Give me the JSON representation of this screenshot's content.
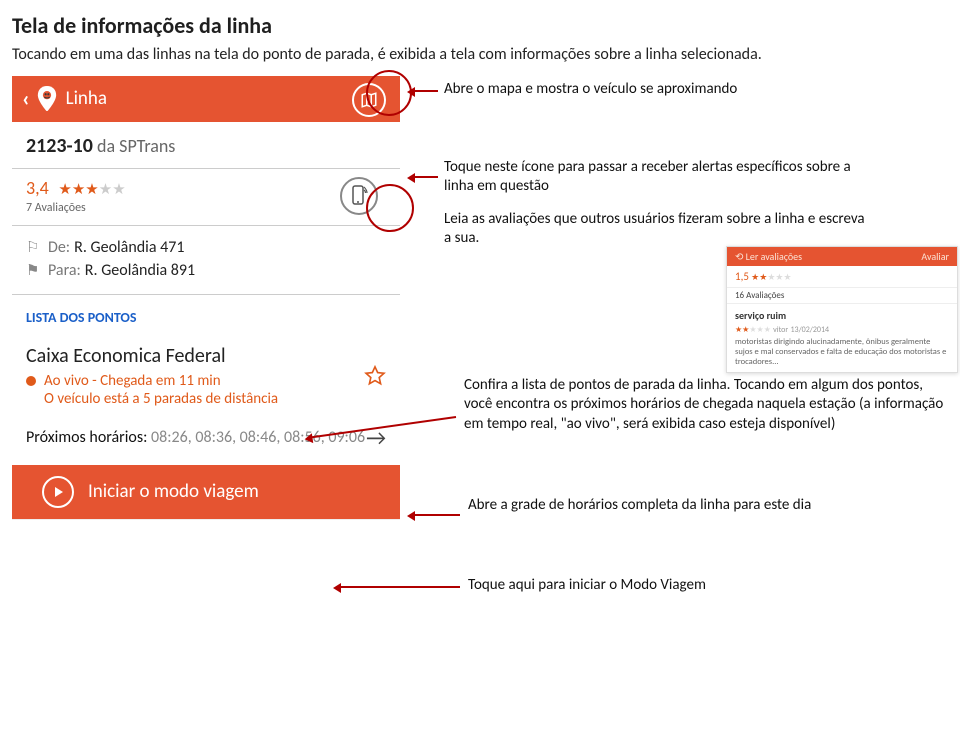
{
  "title": "Tela de informações da linha",
  "subtitle": "Tocando em uma das linhas na tela do ponto de parada, é exibida a tela com informações sobre a linha selecionada.",
  "phone": {
    "header_title": "Linha",
    "route_code": "2123-10",
    "route_operator": " da SPTrans",
    "rating_value": "3,4",
    "rating_count_label": "7 Avaliações",
    "from_label": "De:",
    "from_value": "R. Geolândia 471",
    "to_label": "Para:",
    "to_value": "R. Geolândia 891",
    "list_title": "LISTA DOS PONTOS",
    "stop_name": "Caixa Economica Federal",
    "live_line1": "Ao vivo - Chegada em 11 min",
    "live_line2": "O veículo está a 5 paradas de distância",
    "next_label": "Próximos horários: ",
    "next_times": "08:26, 08:36, 08:46, 08:56, 09:06",
    "start_label": "Iniciar o modo viagem"
  },
  "annotations": {
    "map": "Abre o mapa e mostra o veículo se aproximando",
    "alert": "Toque neste ícone para passar a receber alertas específicos sobre a linha em questão",
    "reviews": "Leia as avaliações que outros usuários fizeram sobre a linha e escreva a sua.",
    "stops": "Confira a lista de pontos de parada da linha. Tocando em algum dos pontos, você encontra os próximos horários de chegada naquela estação (a informação em tempo real, \"ao vivo\", será exibida caso esteja disponível)",
    "grid": "Abre a grade de horários completa da linha para este dia",
    "trip": "Toque aqui para iniciar o Modo Viagem"
  },
  "mini": {
    "left": "Ler avaliações",
    "right": "Avaliar",
    "score": "1,5",
    "count": "16 Avaliações",
    "review_title": "serviço ruim",
    "review_user": "vitor",
    "review_date": "13/02/2014",
    "review_body": "motoristas dirigindo alucinadamente, ônibus geralmente sujos e mal conservados e falta de educação dos motoristas e trocadores..."
  }
}
